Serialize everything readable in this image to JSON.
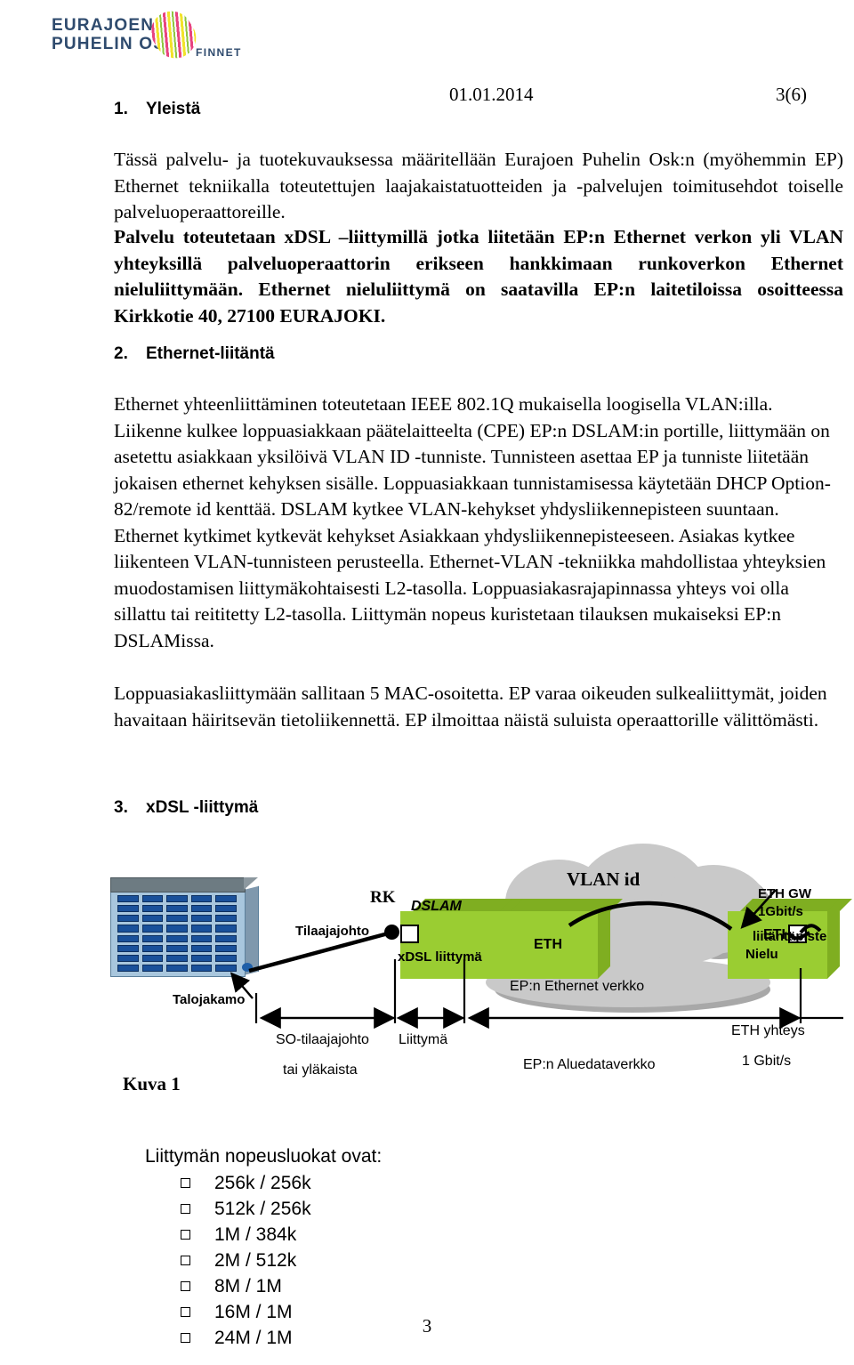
{
  "logo": {
    "line1": "EURAJOEN",
    "line2": "PUHELIN OSK",
    "partner": "FINNET"
  },
  "header": {
    "date": "01.01.2014",
    "page_ref": "3(6)"
  },
  "sections": {
    "s1": {
      "number": "1.",
      "title": "Yleistä"
    },
    "s2": {
      "number": "2.",
      "title": "Ethernet-liitäntä"
    },
    "s3": {
      "number": "3.",
      "title": "xDSL -liittymä"
    }
  },
  "paragraphs": {
    "intro": "Tässä palvelu- ja tuotekuvauksessa määritellään Eurajoen Puhelin Osk:n (myöhemmin EP) Ethernet tekniikalla toteutettujen laajakaistatuotteiden ja -palvelujen toimitusehdot toiselle palveluoperaattoreille.",
    "service_bold": "Palvelu toteutetaan xDSL –liittymillä jotka liitetään EP:n Ethernet verkon yli VLAN yhteyksillä palveluoperaattorin erikseen hankkimaan runkoverkon Ethernet nieluliittymään. Ethernet nieluliittymä on saatavilla EP:n laitetiloissa osoitteessa Kirkkotie 40, 27100 EURAJOKI.",
    "ethernet": "Ethernet yhteenliittäminen toteutetaan IEEE 802.1Q mukaisella loogisella VLAN:illa. Liikenne kulkee loppuasiakkaan päätelaitteelta (CPE) EP:n DSLAM:in portille, liittymään on asetettu asiakkaan yksilöivä VLAN ID -tunniste. Tunnisteen asettaa EP ja tunniste liitetään jokaisen ethernet kehyksen sisälle. Loppuasiakkaan tunnistamisessa käytetään DHCP Option-82/remote id kenttää. DSLAM kytkee VLAN-kehykset yhdysliikennepisteen suuntaan. Ethernet kytkimet kytkevät kehykset Asiakkaan yhdysliikennepisteeseen. Asiakas kytkee liikenteen  VLAN-tunnisteen perusteella. Ethernet-VLAN -tekniikka mahdollistaa yhteyksien muodostamisen liittymäkohtaisesti L2-tasolla. Loppuasiakasrajapinnassa yhteys voi olla sillattu tai reititetty L2-tasolla. Liittymän nopeus kuristetaan tilauksen mukaiseksi EP:n DSLAMissa.",
    "mac": "Loppuasiakasliittymään sallitaan 5 MAC-osoitetta. EP varaa oikeuden sulkealiittymät, joiden havaitaan häiritsevän tietoliikennettä. EP ilmoittaa näistä suluista operaattorille välittömästi."
  },
  "diagram": {
    "caption": "Kuva 1",
    "building_label": "Talojakamo",
    "subscriber_line": "Tilaajajohto",
    "rk": "RK",
    "dslam_title": "DSLAM",
    "dslam_sub": "xDSL liittymä",
    "eth_left": "ETH",
    "eth_right": "ETH",
    "eth_right_sub": "Nielu",
    "vlan_id": "VLAN id",
    "cloud_label": "EP:n Ethernet verkko",
    "gw_line1": "ETH GW",
    "gw_line2": "1Gbit/s",
    "gw_line3": "liitäntäpiste",
    "dim_so_1": "SO-tilaajajohto",
    "dim_so_2": "tai yläkaista",
    "dim_liittyma": "Liittymä",
    "dim_aluedata": "EP:n Aluedataverkko",
    "dim_eth_1": "ETH yhteys",
    "dim_eth_2": "1 Gbit/s"
  },
  "speeds": {
    "title": "Liittymän nopeusluokat ovat:",
    "items": [
      "256k / 256k",
      "512k / 256k",
      "1M / 384k",
      "2M / 512k",
      "8M / 1M",
      "16M / 1M",
      "24M / 1M"
    ]
  },
  "footer": {
    "page": "3"
  },
  "colors": {
    "logo_blue": "#2f4b6e",
    "box_green": "#9acd32",
    "box_green_dark": "#7fae21",
    "cloud_gray": "#c9c9c9",
    "building_blue": "#a8c6dd",
    "window_blue": "#19509a"
  }
}
